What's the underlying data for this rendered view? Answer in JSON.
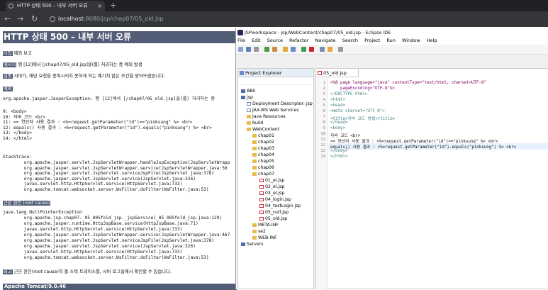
{
  "browser": {
    "tab_title": "HTTP 상태 500 – 내부 서버 오류",
    "tab_close": "×",
    "new_tab": "+",
    "url_host": "localhost",
    "url_path": ":8080/jsp/chap07/05_old.jsp"
  },
  "error_page": {
    "heading": "HTTP 상태 500 – 내부 서버 오류",
    "type_label": "타입",
    "type_value": " 예외 보고",
    "message_label": "메시지",
    "message_value": " 행 [12]에서 [/chap07/05_old.jsp]을(를) 처리하는 중 예외 발생",
    "description_label": "설명",
    "description_value": " 서버가, 해당 요청을 충족시키지 못하게 하는 예기치 않은 조건을 맞닥뜨렸습니다.",
    "exception_label": "예외",
    "exception_line": "org.apache.jasper.JasperException: 행 [12]에서 [/chap07/05_old.jsp]을(를) 처리하는 중",
    "source_lines": [
      "9: <body>",
      "10: 자바 코드 <br>",
      "11: == 연산자 사용 결과 : <%=request.getParameter(\"id\")==\"pinksung\" %> <br>",
      "12: equals() 사용 결과 : <%=request.getParameter(\"id\").equals(\"pinksung\") %> <br>",
      "13: </body>",
      "14: </html>"
    ],
    "stacktrace_title": "Stacktrace:",
    "stacktrace_lines": [
      "        org.apache.jasper.servlet.JspServletWrapper.handleJspException(JspServletWrapp",
      "        org.apache.jasper.servlet.JspServletWrapper.service(JspServletWrapper.java:50",
      "        org.apache.jasper.servlet.JspServlet.serviceJspFile(JspServlet.java:378)",
      "        org.apache.jasper.servlet.JspServlet.service(JspServlet.java:326)",
      "        javax.servlet.http.HttpServlet.service(HttpServlet.java:733)",
      "        org.apache.tomcat.websocket.server.WsFilter.doFilter(WsFilter.java:53)"
    ],
    "root_cause_label": "근본 원인 (root cause)",
    "root_cause_lines": [
      "java.lang.NullPointerException",
      "        org.apache.jsp.chap07._05_005fold_jsp._jspService(_05_005fold_jsp.java:129)",
      "        org.apache.jasper.runtime.HttpJspBase.service(HttpJspBase.java:71)",
      "        javax.servlet.http.HttpServlet.service(HttpServlet.java:733)",
      "        org.apache.jasper.servlet.JspServletWrapper.service(JspServletWrapper.java:467",
      "        org.apache.jasper.servlet.JspServlet.serviceJspFile(JspServlet.java:378)",
      "        org.apache.jasper.servlet.JspServlet.service(JspServlet.java:326)",
      "        javax.servlet.http.HttpServlet.service(HttpServlet.java:733)",
      "        org.apache.tomcat.websocket.server.WsFilter.doFilter(WsFilter.java:53)"
    ],
    "note_label": "비고",
    "note_value": " 근본 원인(root cause)의 풀 스택 트레이스를, 서버 로그들에서 확인할 수 있습니다.",
    "footer": "Apache Tomcat/9.0.46"
  },
  "eclipse": {
    "title": "JSPworkspace - jsp/WebContent/chap07/05_old.jsp - Eclipse IDE",
    "menu": [
      "File",
      "Edit",
      "Source",
      "Refactor",
      "Navigate",
      "Search",
      "Project",
      "Run",
      "Window",
      "Help"
    ],
    "project_explorer_title": "Project Explorer",
    "tree": [
      {
        "label": "BBS",
        "kind": "proj"
      },
      {
        "label": "jsp",
        "kind": "proj"
      },
      {
        "label": "Deployment Descriptor: jsp",
        "kind": "file"
      },
      {
        "label": "JAX-WS Web Services",
        "kind": "file"
      },
      {
        "label": "Java Resources",
        "kind": "fold"
      },
      {
        "label": "build",
        "kind": "fold"
      },
      {
        "label": "WebContent",
        "kind": "fold"
      },
      {
        "label": "chap01",
        "kind": "fold"
      },
      {
        "label": "chap02",
        "kind": "fold"
      },
      {
        "label": "chap03",
        "kind": "fold"
      },
      {
        "label": "chap04",
        "kind": "fold"
      },
      {
        "label": "chap05",
        "kind": "fold"
      },
      {
        "label": "chap06",
        "kind": "fold"
      },
      {
        "label": "chap07",
        "kind": "fold"
      },
      {
        "label": "01_el.jsp",
        "kind": "jsp"
      },
      {
        "label": "02_el.jsp",
        "kind": "jsp"
      },
      {
        "label": "03_el.jsp",
        "kind": "jsp"
      },
      {
        "label": "04_login.jsp",
        "kind": "jsp"
      },
      {
        "label": "04_testLogin.jsp",
        "kind": "jsp"
      },
      {
        "label": "05_null.jsp",
        "kind": "jsp"
      },
      {
        "label": "05_old.jsp",
        "kind": "jsp"
      },
      {
        "label": "META-INF",
        "kind": "fold"
      },
      {
        "label": "se2",
        "kind": "fold"
      },
      {
        "label": "WEB-INF",
        "kind": "fold"
      },
      {
        "label": "Servers",
        "kind": "proj"
      }
    ],
    "editor_tab": "05_old.jsp",
    "line_numbers": [
      "1",
      "2",
      "3",
      "4",
      "5",
      "6",
      "7",
      "8",
      "9",
      "10",
      "11",
      "12",
      "13",
      "14"
    ],
    "code_lines": [
      "<%@ page language=\"java\" contentType=\"text/html; charset=UTF-8\"",
      "    pageEncoding=\"UTF-8\"%>",
      "<!DOCTYPE html>",
      "<html>",
      "<head>",
      "<meta charset=\"UTF-8\">",
      "<title>자바 코드 방법</title>",
      "</head>",
      "<body>",
      "자바 코드 <br>",
      "== 연산자 사용 결과 : <%=request.getParameter(\"id\")==\"pinksung\" %> <br>",
      "equals() 사용 결과 : <%=request.getParameter(\"id\").equals(\"pinksung\") %> <br>",
      "</body>",
      "</html>"
    ]
  }
}
